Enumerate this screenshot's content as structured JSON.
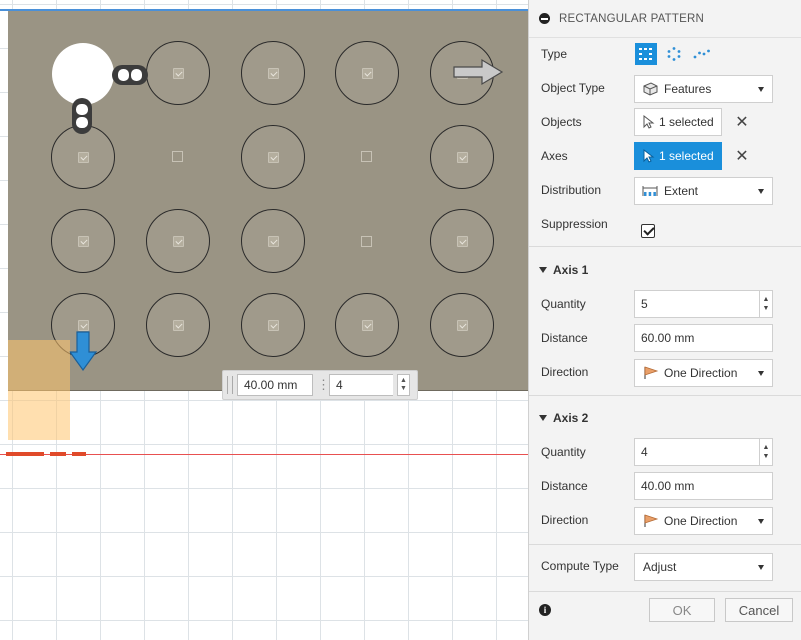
{
  "inline_manipulator": {
    "distance_value": "40.00 mm",
    "quantity_value": "4"
  },
  "pattern_grid": {
    "rows": 4,
    "columns": 5,
    "suppressed_instances": [
      "r2c2",
      "r2c4",
      "r3c4"
    ]
  },
  "panel": {
    "title": "RECTANGULAR PATTERN",
    "type_label": "Type",
    "object_type": {
      "label": "Object Type",
      "value": "Features",
      "icon": "features-icon"
    },
    "objects": {
      "label": "Objects",
      "value": "1 selected"
    },
    "axes": {
      "label": "Axes",
      "value": "1 selected"
    },
    "distribution": {
      "label": "Distribution",
      "value": "Extent",
      "icon": "extent-icon"
    },
    "suppression": {
      "label": "Suppression",
      "checked": true
    },
    "axis1": {
      "title": "Axis 1",
      "quantity_label": "Quantity",
      "quantity": "5",
      "distance_label": "Distance",
      "distance": "60.00 mm",
      "direction_label": "Direction",
      "direction": "One Direction"
    },
    "axis2": {
      "title": "Axis 2",
      "quantity_label": "Quantity",
      "quantity": "4",
      "distance_label": "Distance",
      "distance": "40.00 mm",
      "direction_label": "Direction",
      "direction": "One Direction"
    },
    "compute_type": {
      "label": "Compute Type",
      "value": "Adjust"
    },
    "ok_label": "OK",
    "cancel_label": "Cancel"
  },
  "colors": {
    "accent": "#1a8fdb",
    "sketch_fill": "#9a9484",
    "panel_bg": "#f3f3f3"
  }
}
